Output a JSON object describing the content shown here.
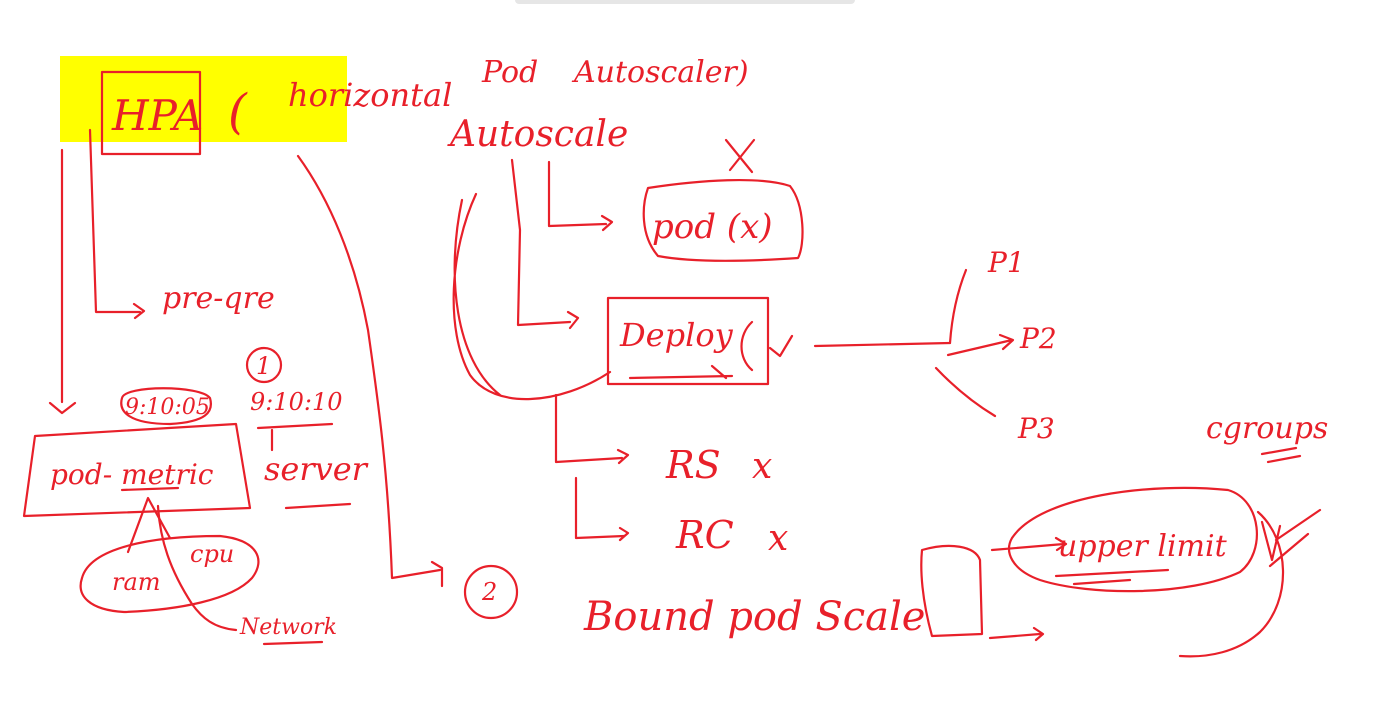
{
  "colors": {
    "ink": "#e8202a",
    "highlight": "#ffff00",
    "background": "#ffffff"
  },
  "labels": {
    "hpa": "HPA",
    "paren_open": "(",
    "horizontal": "horizontal",
    "pod": "Pod",
    "autoscaler": "Autoscaler)",
    "autoscale": "Autoscale",
    "pod_x": "pod (x)",
    "deploy": "Deploy",
    "p1": "P1",
    "p2": "P2",
    "p3": "P3",
    "rs": "RS",
    "rc": "RC",
    "x_mark": "x",
    "preqreq": "pre-qre",
    "circle_1": "1",
    "time_1": "9:10:05",
    "time_2": "9:10:10",
    "server": "server",
    "pod_metric": "pod- metric",
    "ram": "ram",
    "cpu": "cpu",
    "network": "Network",
    "circle_2": "2",
    "bound_pod_scale": "Bound pod Scale",
    "upper_limit": "upper limit",
    "cgroups": "cgroups"
  }
}
